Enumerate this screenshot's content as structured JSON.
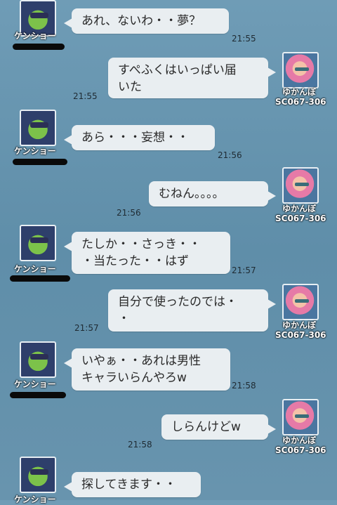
{
  "users": {
    "left": {
      "name": "ケンショー"
    },
    "right": {
      "name": "ゆかんぼ",
      "id": "SC067-306"
    }
  },
  "messages": [
    {
      "side": "left",
      "text": "あれ、ないわ・・夢？",
      "time": "21:55"
    },
    {
      "side": "right",
      "text": "すぺふくはいっぱい届\nいた",
      "time": "21:55"
    },
    {
      "side": "left",
      "text": "あら・・・妄想・・",
      "time": "21:56"
    },
    {
      "side": "right",
      "text": "むねん。。。。",
      "time": "21:56"
    },
    {
      "side": "left",
      "text": "たしか・・さっき・・\n・当たった・・はず",
      "time": "21:57"
    },
    {
      "side": "right",
      "text": "自分で使ったのでは・\n・",
      "time": "21:57"
    },
    {
      "side": "left",
      "text": "いやぁ・・あれは男性\nキャラいらんやろw",
      "time": "21:58"
    },
    {
      "side": "right",
      "text": "しらんけどw",
      "time": "21:58"
    },
    {
      "side": "left",
      "text": "探してきます・・",
      "time": ""
    }
  ]
}
